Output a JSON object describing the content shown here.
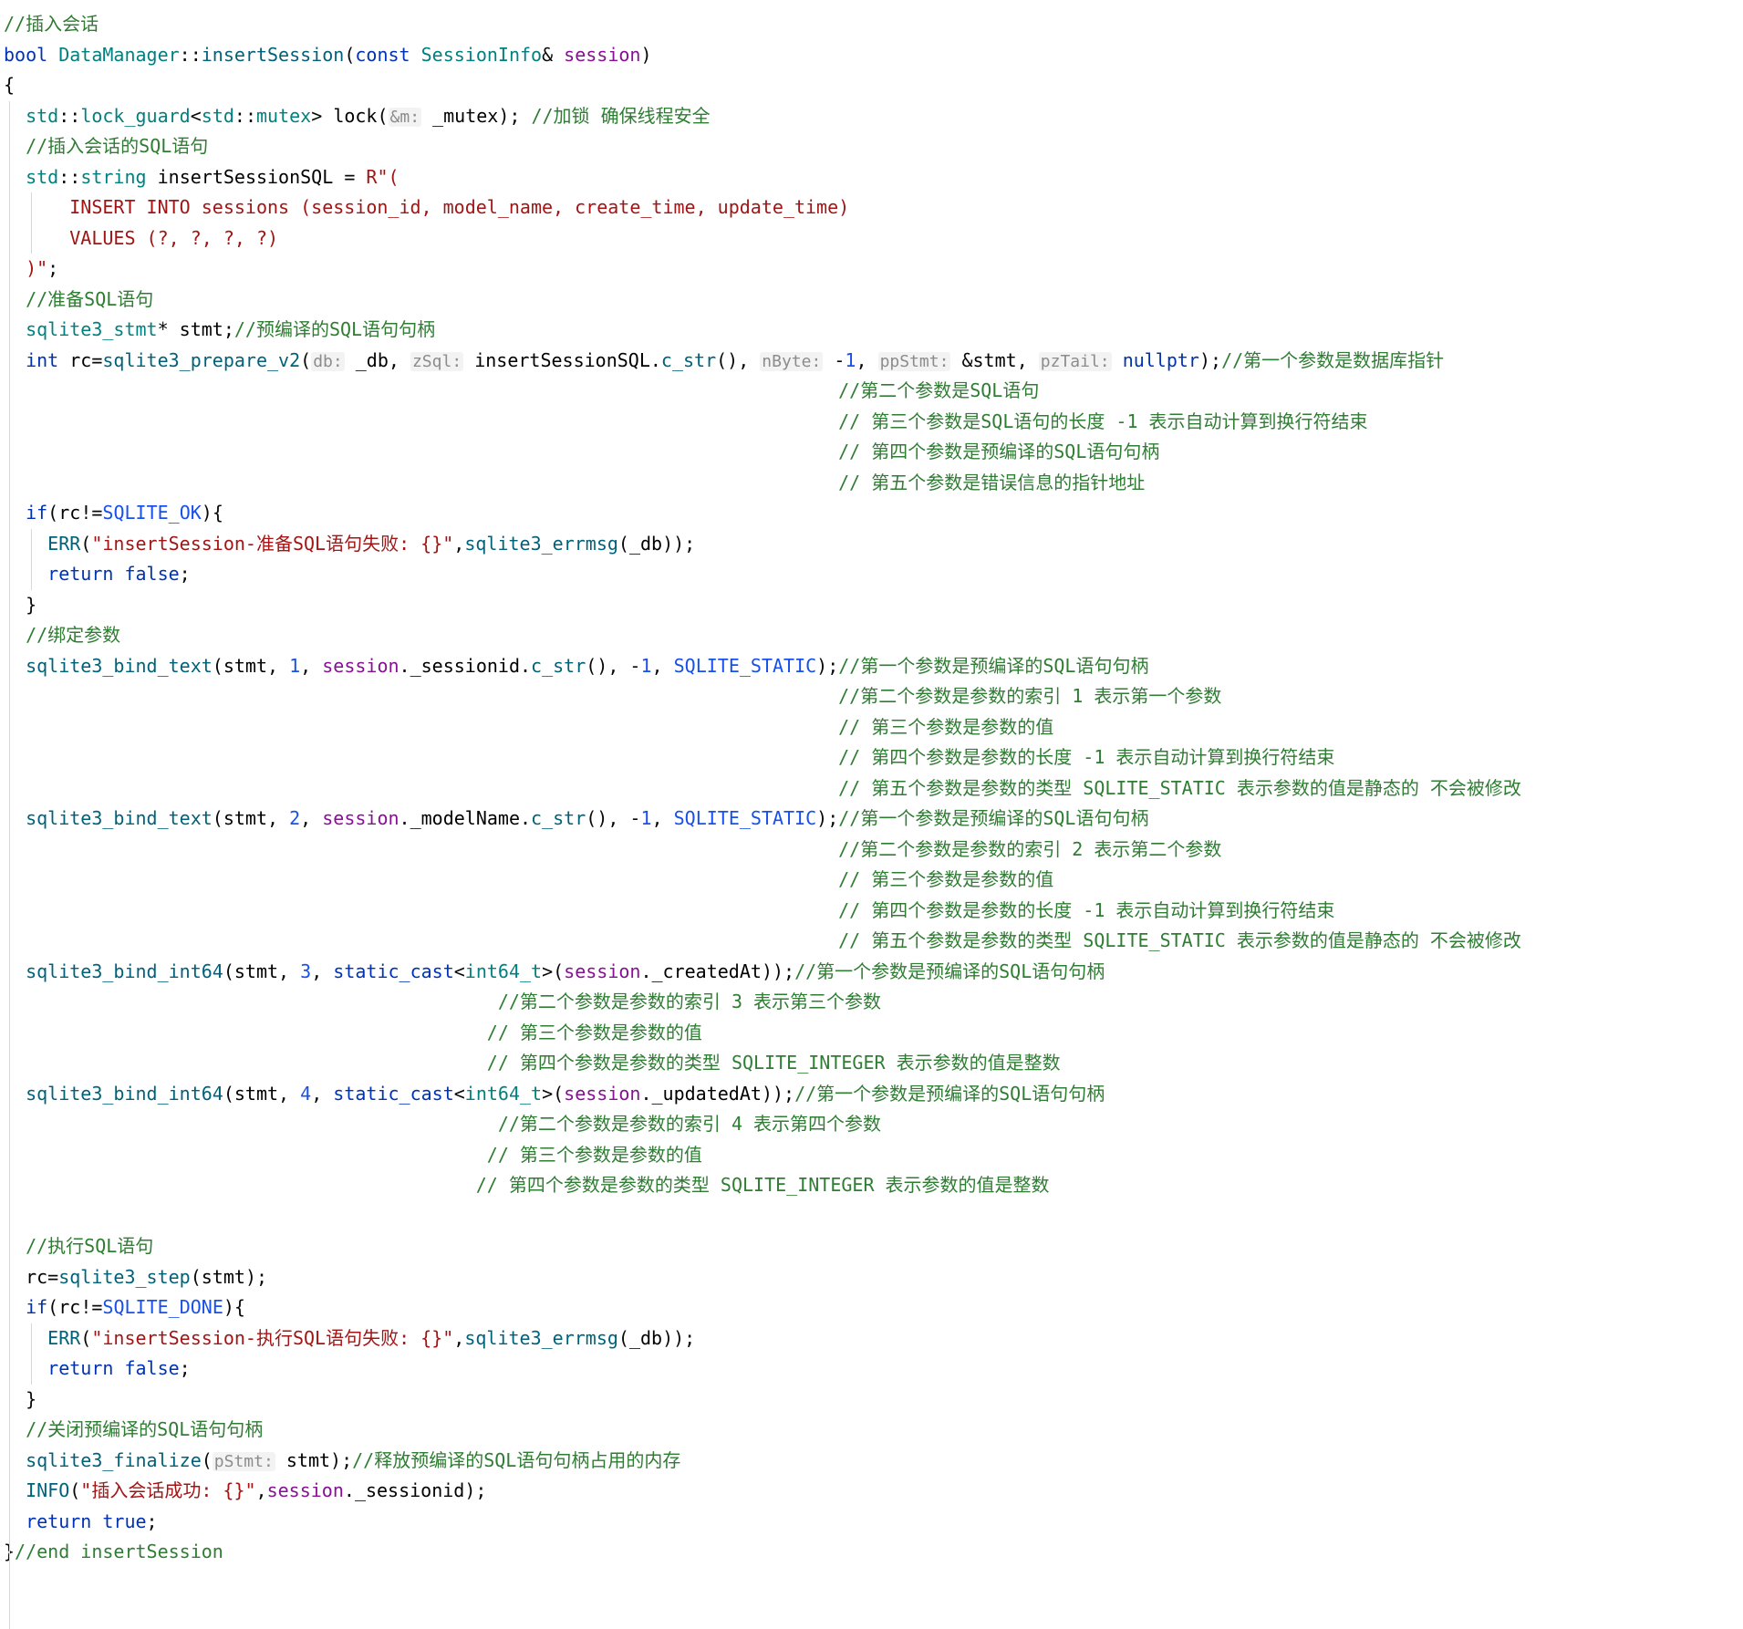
{
  "editor": {
    "language": "C++",
    "colors": {
      "background": "#ffffff",
      "comment": "#2e7d32",
      "keyword": "#0033b3",
      "type": "#008080",
      "function": "#00627a",
      "string": "#a31515",
      "number": "#1750eb",
      "hint": "#8c8c8c",
      "indent_guide": "#d8d8d8"
    },
    "lines": [
      [
        [
          "c-comment",
          "//插入会话"
        ]
      ],
      [
        [
          "c-kw",
          "bool "
        ],
        [
          "c-type",
          "DataManager"
        ],
        [
          "c-punct",
          "::"
        ],
        [
          "c-fn",
          "insertSession"
        ],
        [
          "c-punct",
          "("
        ],
        [
          "c-kw",
          "const "
        ],
        [
          "c-type",
          "SessionInfo"
        ],
        [
          "c-punct",
          "& "
        ],
        [
          "c-param",
          "session"
        ],
        [
          "c-punct",
          ")"
        ]
      ],
      [
        [
          "c-punct",
          "{"
        ]
      ],
      [
        [
          "c-type",
          "  std"
        ],
        [
          "c-punct",
          "::"
        ],
        [
          "c-type",
          "lock_guard"
        ],
        [
          "c-punct",
          "<"
        ],
        [
          "c-type",
          "std"
        ],
        [
          "c-punct",
          "::"
        ],
        [
          "c-type",
          "mutex"
        ],
        [
          "c-punct",
          "> "
        ],
        [
          "c-obj",
          "lock"
        ],
        [
          "c-punct",
          "("
        ],
        [
          "c-hint",
          "&m:"
        ],
        [
          "c-punct",
          " "
        ],
        [
          "c-obj",
          "_mutex"
        ],
        [
          "c-punct",
          "); "
        ],
        [
          "c-comment",
          "//加锁 确保线程安全"
        ]
      ],
      [
        [
          "c-comment",
          "  //插入会话的SQL语句"
        ]
      ],
      [
        [
          "c-type",
          "  std"
        ],
        [
          "c-punct",
          "::"
        ],
        [
          "c-type",
          "string "
        ],
        [
          "c-obj",
          "insertSessionSQL "
        ],
        [
          "c-punct",
          "= "
        ],
        [
          "c-str",
          "R\"("
        ]
      ],
      [
        [
          "c-str",
          "      INSERT INTO sessions (session_id, model_name, create_time, update_time)"
        ]
      ],
      [
        [
          "c-str",
          "      VALUES (?, ?, ?, ?)"
        ]
      ],
      [
        [
          "c-str",
          "  )\""
        ],
        [
          "c-punct",
          ";"
        ]
      ],
      [
        [
          "c-comment",
          "  //准备SQL语句"
        ]
      ],
      [
        [
          "c-type",
          "  sqlite3_stmt"
        ],
        [
          "c-punct",
          "* "
        ],
        [
          "c-obj",
          "stmt"
        ],
        [
          "c-punct",
          ";"
        ],
        [
          "c-comment",
          "//预编译的SQL语句句柄"
        ]
      ],
      [
        [
          "c-kw",
          "  int "
        ],
        [
          "c-obj",
          "rc"
        ],
        [
          "c-punct",
          "="
        ],
        [
          "c-fn",
          "sqlite3_prepare_v2"
        ],
        [
          "c-punct",
          "("
        ],
        [
          "c-hint",
          "db:"
        ],
        [
          "c-punct",
          " "
        ],
        [
          "c-obj",
          "_db"
        ],
        [
          "c-punct",
          ", "
        ],
        [
          "c-hint",
          "zSql:"
        ],
        [
          "c-punct",
          " "
        ],
        [
          "c-obj",
          "insertSessionSQL"
        ],
        [
          "c-punct",
          "."
        ],
        [
          "c-method",
          "c_str"
        ],
        [
          "c-punct",
          "(), "
        ],
        [
          "c-hint",
          "nByte:"
        ],
        [
          "c-punct",
          " -"
        ],
        [
          "c-num",
          "1"
        ],
        [
          "c-punct",
          ", "
        ],
        [
          "c-hint",
          "ppStmt:"
        ],
        [
          "c-punct",
          " &"
        ],
        [
          "c-obj",
          "stmt"
        ],
        [
          "c-punct",
          ", "
        ],
        [
          "c-hint",
          "pzTail:"
        ],
        [
          "c-punct",
          " "
        ],
        [
          "c-kw",
          "nullptr"
        ],
        [
          "c-punct",
          ");"
        ],
        [
          "c-comment",
          "//第一个参数是数据库指针"
        ]
      ],
      [
        [
          "c-comment",
          "                                                                            //第二个参数是SQL语句"
        ]
      ],
      [
        [
          "c-comment",
          "                                                                            // 第三个参数是SQL语句的长度 -1 表示自动计算到换行符结束"
        ]
      ],
      [
        [
          "c-comment",
          "                                                                            // 第四个参数是预编译的SQL语句句柄"
        ]
      ],
      [
        [
          "c-comment",
          "                                                                            // 第五个参数是错误信息的指针地址"
        ]
      ],
      [
        [
          "c-kw",
          "  if"
        ],
        [
          "c-punct",
          "("
        ],
        [
          "c-obj",
          "rc"
        ],
        [
          "c-punct",
          "!="
        ],
        [
          "c-macro",
          "SQLITE_OK"
        ],
        [
          "c-punct",
          "){"
        ]
      ],
      [
        [
          "c-fn",
          "    ERR"
        ],
        [
          "c-punct",
          "("
        ],
        [
          "c-str",
          "\"insertSession-准备SQL语句失败: {}\""
        ],
        [
          "c-punct",
          ","
        ],
        [
          "c-fn",
          "sqlite3_errmsg"
        ],
        [
          "c-punct",
          "("
        ],
        [
          "c-obj",
          "_db"
        ],
        [
          "c-punct",
          "));"
        ]
      ],
      [
        [
          "c-kw",
          "    return false"
        ],
        [
          "c-punct",
          ";"
        ]
      ],
      [
        [
          "c-punct",
          "  }"
        ]
      ],
      [
        [
          "c-comment",
          "  //绑定参数"
        ]
      ],
      [
        [
          "c-fn",
          "  sqlite3_bind_text"
        ],
        [
          "c-punct",
          "("
        ],
        [
          "c-obj",
          "stmt"
        ],
        [
          "c-punct",
          ", "
        ],
        [
          "c-num",
          "1"
        ],
        [
          "c-punct",
          ", "
        ],
        [
          "c-param",
          "session"
        ],
        [
          "c-punct",
          "."
        ],
        [
          "c-obj",
          "_sessionid"
        ],
        [
          "c-punct",
          "."
        ],
        [
          "c-method",
          "c_str"
        ],
        [
          "c-punct",
          "(), -"
        ],
        [
          "c-num",
          "1"
        ],
        [
          "c-punct",
          ", "
        ],
        [
          "c-macro",
          "SQLITE_STATIC"
        ],
        [
          "c-punct",
          ");"
        ],
        [
          "c-comment",
          "//第一个参数是预编译的SQL语句句柄"
        ]
      ],
      [
        [
          "c-comment",
          "                                                                            //第二个参数是参数的索引 1 表示第一个参数"
        ]
      ],
      [
        [
          "c-comment",
          "                                                                            // 第三个参数是参数的值"
        ]
      ],
      [
        [
          "c-comment",
          "                                                                            // 第四个参数是参数的长度 -1 表示自动计算到换行符结束"
        ]
      ],
      [
        [
          "c-comment",
          "                                                                            // 第五个参数是参数的类型 SQLITE_STATIC 表示参数的值是静态的 不会被修改"
        ]
      ],
      [
        [
          "c-fn",
          "  sqlite3_bind_text"
        ],
        [
          "c-punct",
          "("
        ],
        [
          "c-obj",
          "stmt"
        ],
        [
          "c-punct",
          ", "
        ],
        [
          "c-num",
          "2"
        ],
        [
          "c-punct",
          ", "
        ],
        [
          "c-param",
          "session"
        ],
        [
          "c-punct",
          "."
        ],
        [
          "c-obj",
          "_modelName"
        ],
        [
          "c-punct",
          "."
        ],
        [
          "c-method",
          "c_str"
        ],
        [
          "c-punct",
          "(), -"
        ],
        [
          "c-num",
          "1"
        ],
        [
          "c-punct",
          ", "
        ],
        [
          "c-macro",
          "SQLITE_STATIC"
        ],
        [
          "c-punct",
          ");"
        ],
        [
          "c-comment",
          "//第一个参数是预编译的SQL语句句柄"
        ]
      ],
      [
        [
          "c-comment",
          "                                                                            //第二个参数是参数的索引 2 表示第二个参数"
        ]
      ],
      [
        [
          "c-comment",
          "                                                                            // 第三个参数是参数的值"
        ]
      ],
      [
        [
          "c-comment",
          "                                                                            // 第四个参数是参数的长度 -1 表示自动计算到换行符结束"
        ]
      ],
      [
        [
          "c-comment",
          "                                                                            // 第五个参数是参数的类型 SQLITE_STATIC 表示参数的值是静态的 不会被修改"
        ]
      ],
      [
        [
          "c-fn",
          "  sqlite3_bind_int64"
        ],
        [
          "c-punct",
          "("
        ],
        [
          "c-obj",
          "stmt"
        ],
        [
          "c-punct",
          ", "
        ],
        [
          "c-num",
          "3"
        ],
        [
          "c-punct",
          ", "
        ],
        [
          "c-kw",
          "static_cast"
        ],
        [
          "c-punct",
          "<"
        ],
        [
          "c-type",
          "int64_t"
        ],
        [
          "c-punct",
          ">("
        ],
        [
          "c-param",
          "session"
        ],
        [
          "c-punct",
          "."
        ],
        [
          "c-obj",
          "_createdAt"
        ],
        [
          "c-punct",
          "));"
        ],
        [
          "c-comment",
          "//第一个参数是预编译的SQL语句句柄"
        ]
      ],
      [
        [
          "c-comment",
          "                                             //第二个参数是参数的索引 3 表示第三个参数"
        ]
      ],
      [
        [
          "c-comment",
          "                                            // 第三个参数是参数的值"
        ]
      ],
      [
        [
          "c-comment",
          "                                            // 第四个参数是参数的类型 SQLITE_INTEGER 表示参数的值是整数"
        ]
      ],
      [
        [
          "c-fn",
          "  sqlite3_bind_int64"
        ],
        [
          "c-punct",
          "("
        ],
        [
          "c-obj",
          "stmt"
        ],
        [
          "c-punct",
          ", "
        ],
        [
          "c-num",
          "4"
        ],
        [
          "c-punct",
          ", "
        ],
        [
          "c-kw",
          "static_cast"
        ],
        [
          "c-punct",
          "<"
        ],
        [
          "c-type",
          "int64_t"
        ],
        [
          "c-punct",
          ">("
        ],
        [
          "c-param",
          "session"
        ],
        [
          "c-punct",
          "."
        ],
        [
          "c-obj",
          "_updatedAt"
        ],
        [
          "c-punct",
          "));"
        ],
        [
          "c-comment",
          "//第一个参数是预编译的SQL语句句柄"
        ]
      ],
      [
        [
          "c-comment",
          "                                             //第二个参数是参数的索引 4 表示第四个参数"
        ]
      ],
      [
        [
          "c-comment",
          "                                            // 第三个参数是参数的值"
        ]
      ],
      [
        [
          "c-comment",
          "                                           // 第四个参数是参数的类型 SQLITE_INTEGER 表示参数的值是整数"
        ]
      ],
      [],
      [
        [
          "c-comment",
          "  //执行SQL语句"
        ]
      ],
      [
        [
          "c-obj",
          "  rc"
        ],
        [
          "c-punct",
          "="
        ],
        [
          "c-fn",
          "sqlite3_step"
        ],
        [
          "c-punct",
          "("
        ],
        [
          "c-obj",
          "stmt"
        ],
        [
          "c-punct",
          ");"
        ]
      ],
      [
        [
          "c-kw",
          "  if"
        ],
        [
          "c-punct",
          "("
        ],
        [
          "c-obj",
          "rc"
        ],
        [
          "c-punct",
          "!="
        ],
        [
          "c-macro",
          "SQLITE_DONE"
        ],
        [
          "c-punct",
          "){"
        ]
      ],
      [
        [
          "c-fn",
          "    ERR"
        ],
        [
          "c-punct",
          "("
        ],
        [
          "c-str",
          "\"insertSession-执行SQL语句失败: {}\""
        ],
        [
          "c-punct",
          ","
        ],
        [
          "c-fn",
          "sqlite3_errmsg"
        ],
        [
          "c-punct",
          "("
        ],
        [
          "c-obj",
          "_db"
        ],
        [
          "c-punct",
          "));"
        ]
      ],
      [
        [
          "c-kw",
          "    return false"
        ],
        [
          "c-punct",
          ";"
        ]
      ],
      [
        [
          "c-punct",
          "  }"
        ]
      ],
      [
        [
          "c-comment",
          "  //关闭预编译的SQL语句句柄"
        ]
      ],
      [
        [
          "c-fn",
          "  sqlite3_finalize"
        ],
        [
          "c-punct",
          "("
        ],
        [
          "c-hint",
          "pStmt:"
        ],
        [
          "c-punct",
          " "
        ],
        [
          "c-obj",
          "stmt"
        ],
        [
          "c-punct",
          ");"
        ],
        [
          "c-comment",
          "//释放预编译的SQL语句句柄占用的内存"
        ]
      ],
      [
        [
          "c-fn",
          "  INFO"
        ],
        [
          "c-punct",
          "("
        ],
        [
          "c-str",
          "\"插入会话成功: {}\""
        ],
        [
          "c-punct",
          ","
        ],
        [
          "c-param",
          "session"
        ],
        [
          "c-punct",
          "."
        ],
        [
          "c-obj",
          "_sessionid"
        ],
        [
          "c-punct",
          ");"
        ]
      ],
      [
        [
          "c-kw",
          "  return true"
        ],
        [
          "c-punct",
          ";"
        ]
      ],
      [
        [
          "c-punct",
          "}"
        ],
        [
          "c-comment",
          "//end insertSession"
        ]
      ]
    ]
  }
}
